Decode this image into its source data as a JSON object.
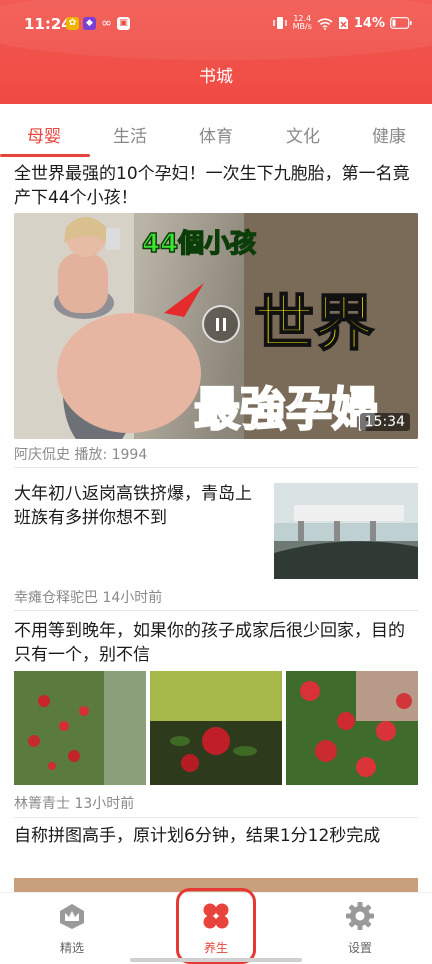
{
  "status_bar": {
    "time": "11:24",
    "speed_top": "12.4",
    "speed_bottom": "MB/s",
    "battery": "14%"
  },
  "header": {
    "title": "书城"
  },
  "tabs": [
    {
      "label": "母婴",
      "active": true
    },
    {
      "label": "生活",
      "active": false
    },
    {
      "label": "体育",
      "active": false
    },
    {
      "label": "文化",
      "active": false
    },
    {
      "label": "健康",
      "active": false
    }
  ],
  "feed": {
    "articles": [
      {
        "title": "全世界最强的10个孕妇！一次生下九胞胎，第一名竟产下44个小孩！",
        "type": "video",
        "thumbnail_overlay": [
          "44個小孩",
          "世界",
          "最強孕婦"
        ],
        "duration": "15:34",
        "meta": "阿庆侃史 播放: 1994"
      },
      {
        "title": "大年初八返岗高铁挤爆，青岛上班族有多拼你想不到",
        "type": "single-image",
        "meta": "幸瘫仓释驼巴 14小时前"
      },
      {
        "title": "不用等到晚年，如果你的孩子成家后很少回家，目的只有一个，别不信",
        "type": "three-images",
        "meta": "林箐青士 13小时前"
      },
      {
        "title": "自称拼图高手，原计划6分钟，结果1分12秒完成",
        "type": "partial"
      }
    ]
  },
  "bottom_nav": [
    {
      "label": "精选",
      "icon": "crown-icon",
      "active": false
    },
    {
      "label": "养生",
      "icon": "grid-icon",
      "active": true
    },
    {
      "label": "设置",
      "icon": "gear-icon",
      "active": false
    }
  ],
  "colors": {
    "accent": "#e8443d",
    "header": "#ef4a43"
  }
}
